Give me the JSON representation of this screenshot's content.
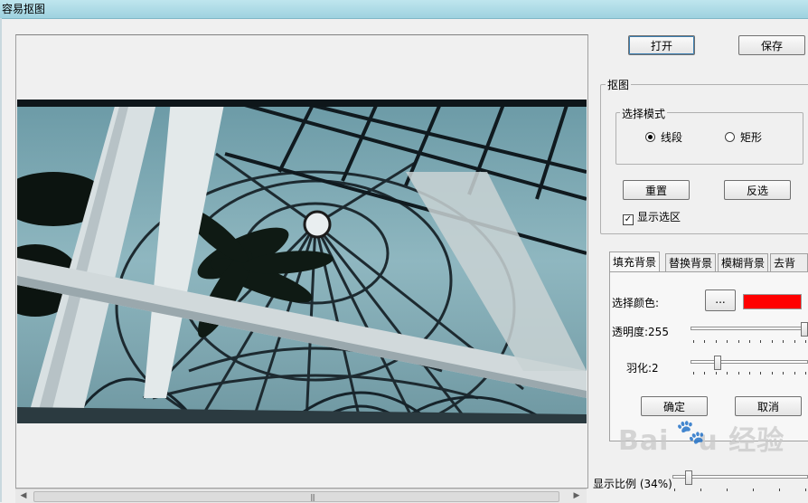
{
  "window": {
    "title": "容易抠图"
  },
  "toolbar": {
    "open_label": "打开",
    "save_label": "保存"
  },
  "matting_group": {
    "legend": "抠图",
    "mode_group": {
      "legend": "选择模式",
      "options": [
        {
          "label": "线段",
          "selected": true
        },
        {
          "label": "矩形",
          "selected": false
        }
      ]
    },
    "reset_label": "重置",
    "invert_label": "反选",
    "show_selection": {
      "label": "显示选区",
      "checked": true
    }
  },
  "tabs": [
    {
      "label": "填充背景",
      "active": true
    },
    {
      "label": "替换背景",
      "active": false
    },
    {
      "label": "模糊背景",
      "active": false
    },
    {
      "label": "去背景",
      "active": false
    }
  ],
  "fill_panel": {
    "color_label": "选择颜色:",
    "browse_label": "...",
    "color_value": "#ff0000",
    "opacity_label": "透明度:255",
    "opacity_value": 255,
    "opacity_max": 255,
    "feather_label": "羽化:2",
    "feather_value": 2,
    "ok_label": "确定",
    "cancel_label": "取消"
  },
  "zoom": {
    "label": "显示比例 (34%)",
    "percent": 34
  },
  "watermark": {
    "text": "Baidu 经验"
  },
  "colors": {
    "titlebar": "#9ed2df",
    "accent_focus": "#3c7fb1"
  }
}
